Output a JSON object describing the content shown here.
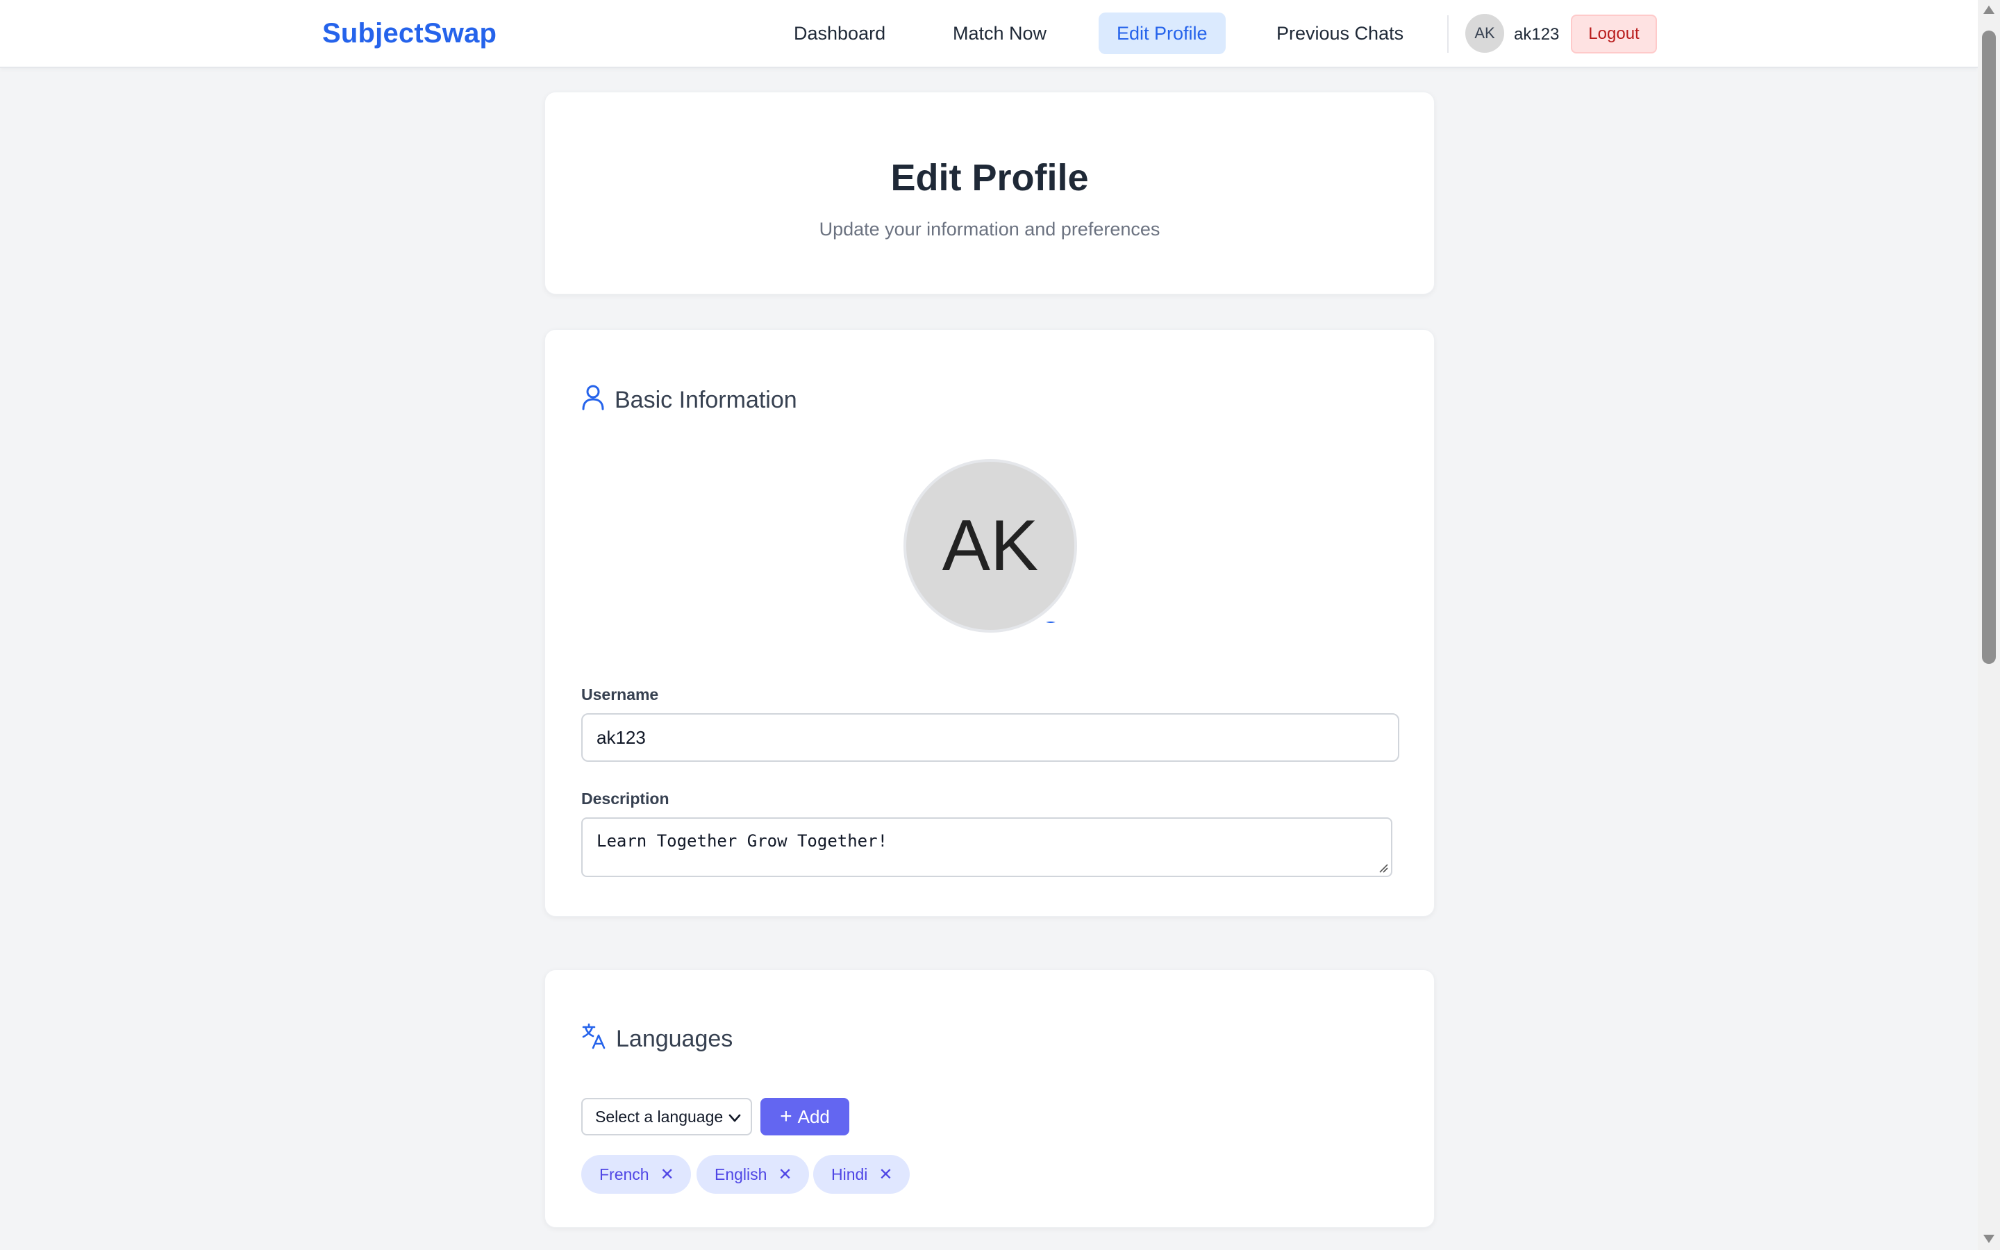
{
  "brand": "SubjectSwap",
  "nav": {
    "dashboard": "Dashboard",
    "match_now": "Match Now",
    "edit_profile": "Edit Profile",
    "previous_chats": "Previous Chats"
  },
  "user": {
    "initials": "AK",
    "username": "ak123",
    "logout": "Logout"
  },
  "header": {
    "title": "Edit Profile",
    "subtitle": "Update your information and preferences"
  },
  "basic_info": {
    "heading": "Basic Information",
    "avatar_initials": "AK",
    "username_label": "Username",
    "username_value": "ak123",
    "description_label": "Description",
    "description_value": "Learn Together Grow Together!"
  },
  "languages": {
    "heading": "Languages",
    "select_placeholder": "Select a language",
    "add_label": "Add",
    "add_glyph": "+",
    "remove_glyph": "✕",
    "chips": [
      "French",
      "English",
      "Hindi"
    ]
  },
  "colors": {
    "brand": "#2563eb",
    "accent": "#6366f1",
    "chip_bg": "#e0e7ff",
    "logout_bg": "#fee2e2",
    "page_bg": "#f3f4f6"
  }
}
